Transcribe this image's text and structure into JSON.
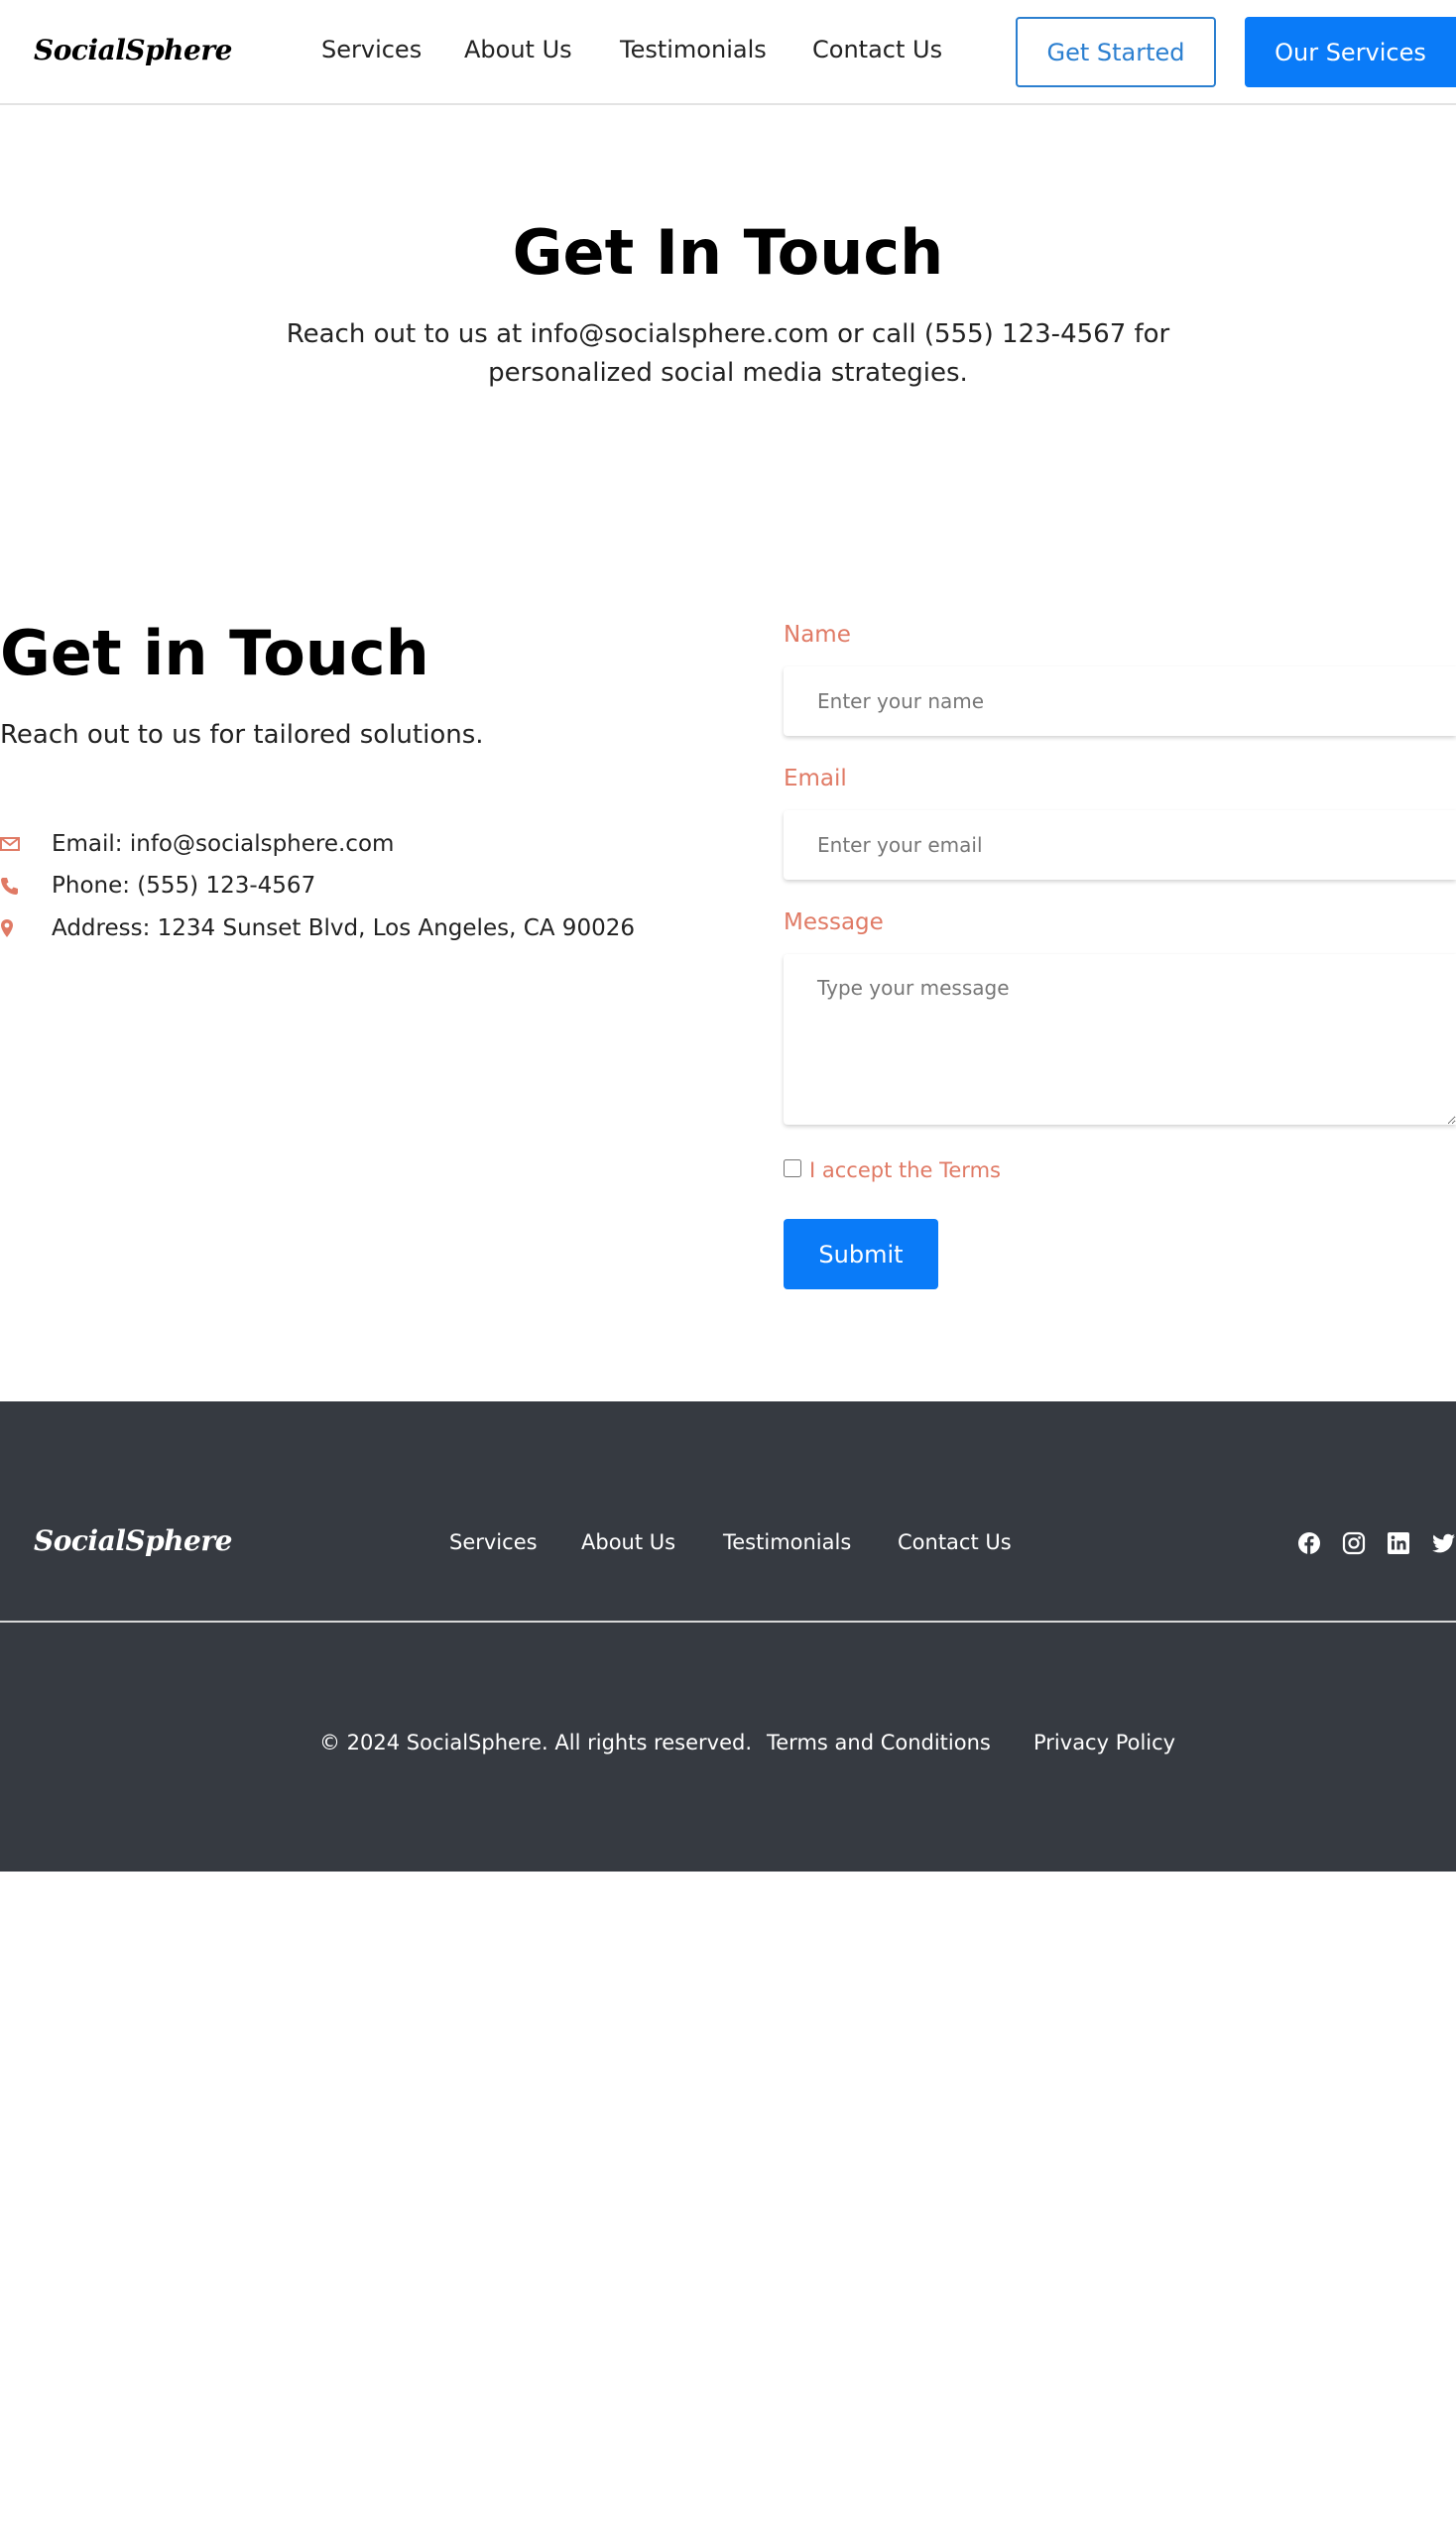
{
  "brand": {
    "name": "SocialSphere"
  },
  "header": {
    "nav": [
      "Services",
      "About Us",
      "Testimonials",
      "Contact Us"
    ],
    "get_started_label": "Get Started",
    "our_services_label": "Our Services"
  },
  "hero": {
    "title": "Get In Touch",
    "subtitle": "Reach out to us at info@socialsphere.com or call (555) 123-4567 for personalized social media strategies."
  },
  "contact": {
    "title": "Get in Touch",
    "subtitle": "Reach out to us for tailored solutions.",
    "info": [
      {
        "icon": "envelope-icon",
        "text": "Email: info@socialsphere.com"
      },
      {
        "icon": "phone-icon",
        "text": "Phone: (555) 123-4567"
      },
      {
        "icon": "map-pin-icon",
        "text": "Address: 1234 Sunset Blvd, Los Angeles, CA 90026"
      }
    ]
  },
  "form": {
    "name_label": "Name",
    "name_placeholder": "Enter your name",
    "email_label": "Email",
    "email_placeholder": "Enter your email",
    "message_label": "Message",
    "message_placeholder": "Type your message",
    "terms_label": "I accept the Terms",
    "submit_label": "Submit"
  },
  "footer": {
    "nav": [
      "Services",
      "About Us",
      "Testimonials",
      "Contact Us"
    ],
    "social": [
      "facebook-icon",
      "instagram-icon",
      "linkedin-icon",
      "twitter-icon"
    ],
    "copyright": "© 2024 SocialSphere. All rights reserved.",
    "terms_link": "Terms and Conditions",
    "privacy_link": "Privacy Policy"
  },
  "colors": {
    "primary": "#0a7bf8",
    "outline_button": "#2b7fd0",
    "accent": "#e07a65",
    "footer_bg": "#363a41"
  }
}
